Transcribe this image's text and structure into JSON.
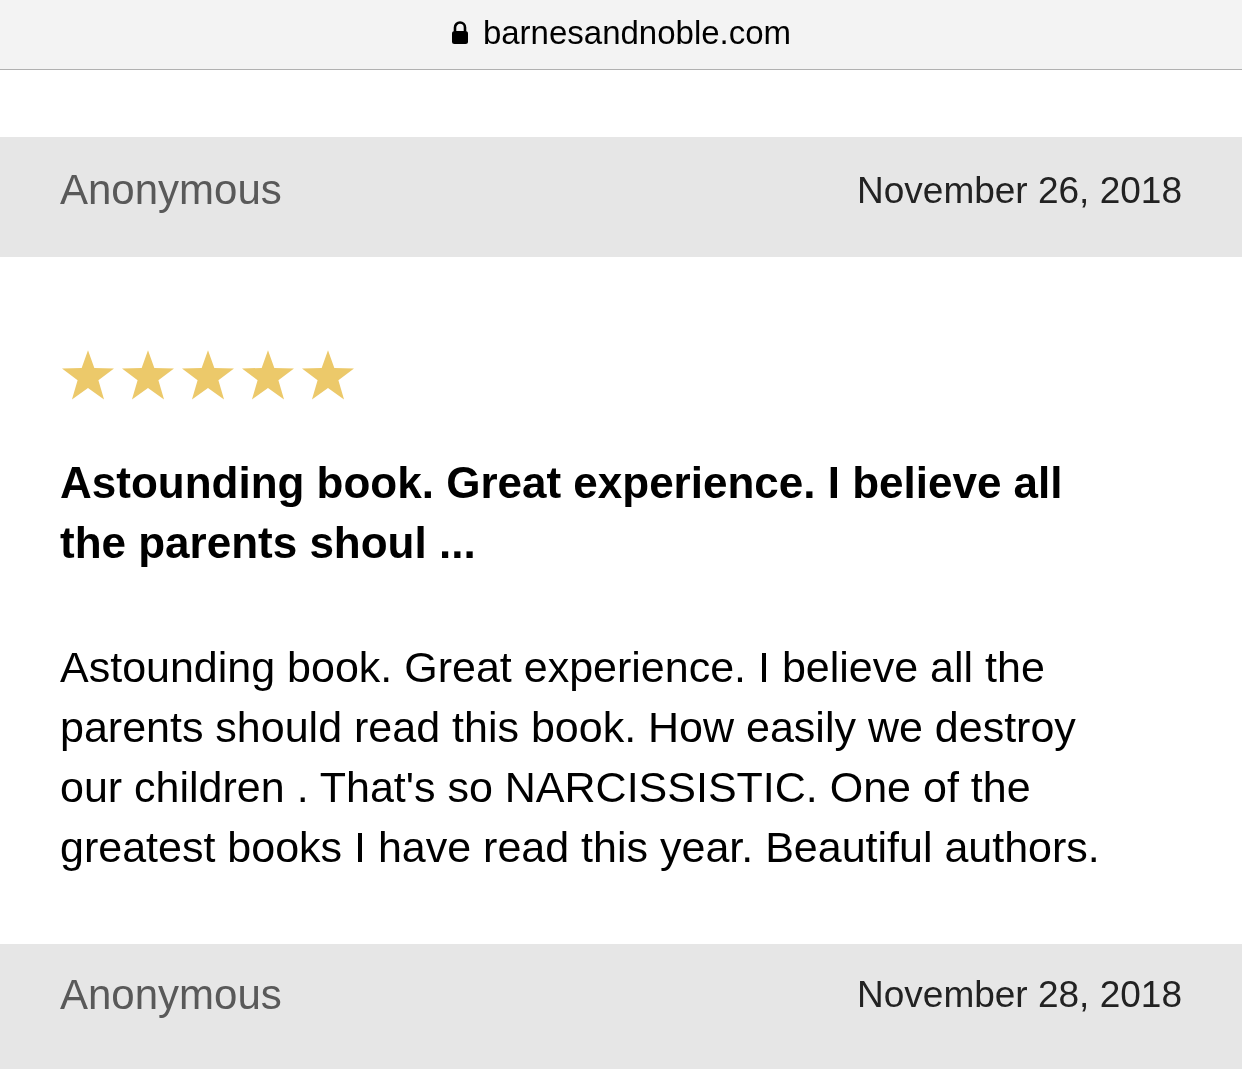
{
  "address_bar": {
    "url": "barnesandnoble.com"
  },
  "reviews": [
    {
      "author": "Anonymous",
      "date": "November 26, 2018",
      "stars": 5,
      "title": "Astounding book. Great experience. I believe all the parents shoul ...",
      "body": "Astounding book. Great experience. I believe all the parents should read this book. How easily we destroy our children . That's so NARCISSISTIC. One of the greatest books I have read this year. Beautiful authors."
    },
    {
      "author": "Anonymous",
      "date": "November 28, 2018"
    }
  ]
}
